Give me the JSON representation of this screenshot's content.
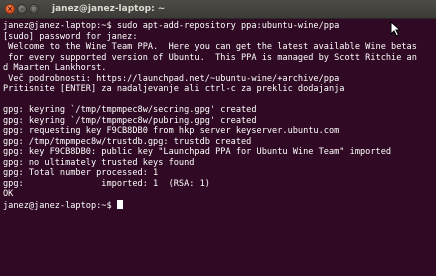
{
  "window": {
    "title": "janez@janez-laptop: ~",
    "close_glyph": "×",
    "minimize_glyph": "–",
    "maximize_glyph": "□"
  },
  "terminal": {
    "lines": [
      "janez@janez-laptop:~$ sudo apt-add-repository ppa:ubuntu-wine/ppa",
      "[sudo] password for janez:",
      " Welcome to the Wine Team PPA.  Here you can get the latest available Wine betas",
      " for every supported version of Ubuntu.  This PPA is managed by Scott Ritchie an",
      "d Maarten Lankhorst.",
      " Več podrobnosti: https://launchpad.net/~ubuntu-wine/+archive/ppa",
      "Pritisnite [ENTER] za nadaljevanje ali ctrl-c za preklic dodajanja",
      "",
      "gpg: keyring `/tmp/tmpmpec8w/secring.gpg' created",
      "gpg: keyring `/tmp/tmpmpec8w/pubring.gpg' created",
      "gpg: requesting key F9CB8DB0 from hkp server keyserver.ubuntu.com",
      "gpg: /tmp/tmpmpec8w/trustdb.gpg: trustdb created",
      "gpg: key F9CB8DB0: public key \"Launchpad PPA for Ubuntu Wine Team\" imported",
      "gpg: no ultimately trusted keys found",
      "gpg: Total number processed: 1",
      "gpg:               imported: 1  (RSA: 1)",
      "OK"
    ],
    "prompt": "janez@janez-laptop:~$ "
  },
  "colors": {
    "background": "#300a24",
    "text": "#ffffff",
    "titlebar": "#3c3b37",
    "close_button": "#df4a16"
  }
}
